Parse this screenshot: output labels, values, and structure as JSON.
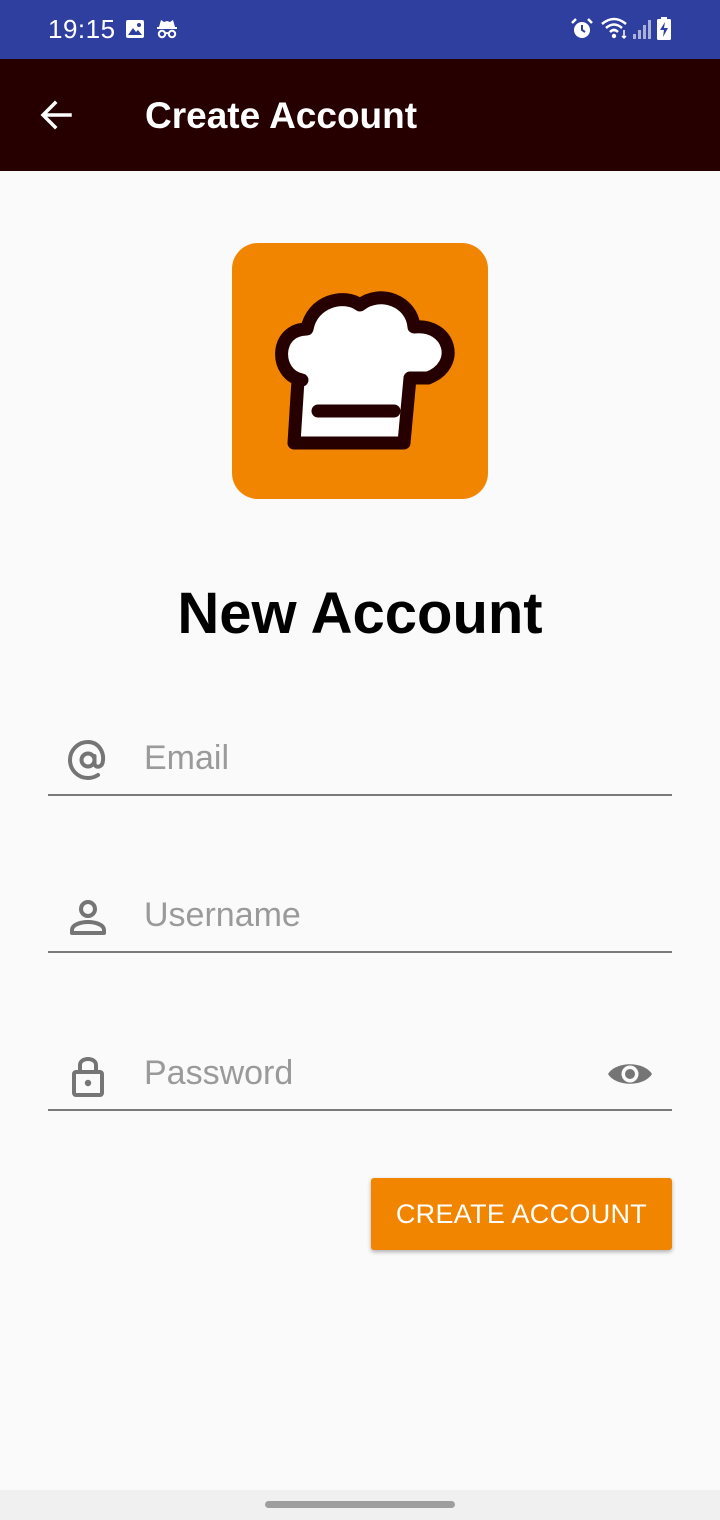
{
  "status_bar": {
    "time": "19:15",
    "icons_left": [
      "image-icon",
      "incognito-icon"
    ],
    "icons_right": [
      "alarm-icon",
      "wifi-icon",
      "signal-icon",
      "battery-charging-icon"
    ]
  },
  "app_bar": {
    "back_icon": "arrow-back-icon",
    "title": "Create Account"
  },
  "logo": {
    "icon": "chef-hat-icon",
    "background_color": "#f28500"
  },
  "heading": "New Account",
  "form": {
    "email": {
      "icon": "at-icon",
      "placeholder": "Email",
      "value": ""
    },
    "username": {
      "icon": "person-icon",
      "placeholder": "Username",
      "value": ""
    },
    "password": {
      "icon": "lock-icon",
      "placeholder": "Password",
      "value": "",
      "toggle_icon": "eye-icon"
    },
    "submit_label": "CREATE ACCOUNT"
  },
  "colors": {
    "status_bar": "#2f3f9f",
    "app_bar": "#260000",
    "accent": "#f28500",
    "background": "#fafafa"
  }
}
